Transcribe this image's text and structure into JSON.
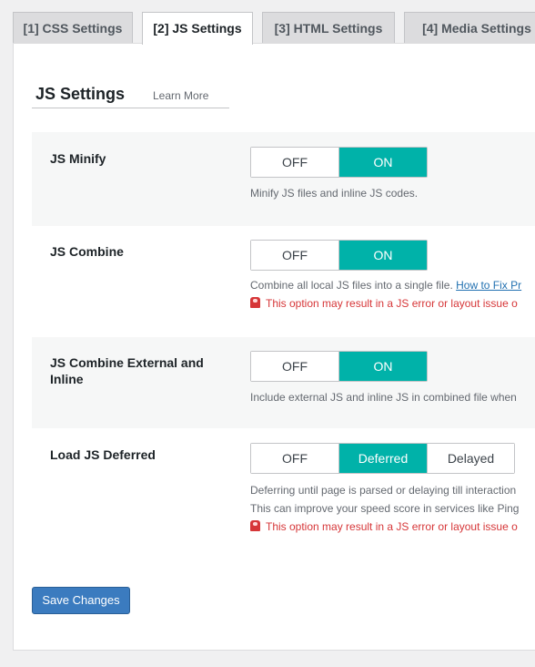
{
  "tabs": [
    {
      "label": "[1] CSS Settings",
      "active": false
    },
    {
      "label": "[2] JS Settings",
      "active": true
    },
    {
      "label": "[3] HTML Settings",
      "active": false
    },
    {
      "label": "[4] Media Settings",
      "active": false
    }
  ],
  "section": {
    "title": "JS Settings",
    "learn_more": "Learn More"
  },
  "settings": [
    {
      "label": "JS Minify",
      "options": [
        "OFF",
        "ON"
      ],
      "selected": "ON",
      "description": "Minify JS files and inline JS codes."
    },
    {
      "label": "JS Combine",
      "options": [
        "OFF",
        "ON"
      ],
      "selected": "ON",
      "description": "Combine all local JS files into a single file.",
      "link": "How to Fix Pr",
      "warning": "This option may result in a JS error or layout issue o"
    },
    {
      "label": "JS Combine External and Inline",
      "options": [
        "OFF",
        "ON"
      ],
      "selected": "ON",
      "description": "Include external JS and inline JS in combined file when"
    },
    {
      "label": "Load JS Deferred",
      "options": [
        "OFF",
        "Deferred",
        "Delayed"
      ],
      "selected": "Deferred",
      "description": "Deferring until page is parsed or delaying till interaction",
      "description2": "This can improve your speed score in services like Ping",
      "warning": "This option may result in a JS error or layout issue o"
    }
  ],
  "save_label": "Save Changes",
  "colors": {
    "accent": "#00b2a9",
    "warning": "#d63638",
    "link": "#2271b1",
    "button": "#3b7bbf"
  }
}
